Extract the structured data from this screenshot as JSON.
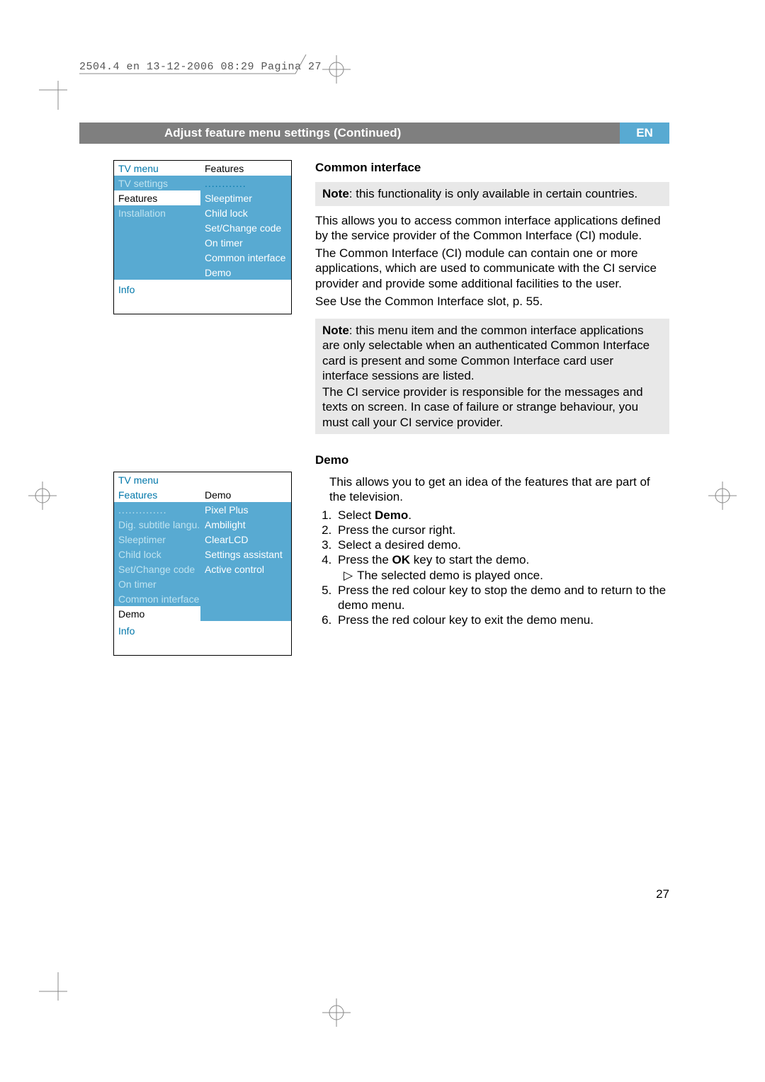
{
  "print_header": "2504.4 en  13-12-2006  08:29  Pagina 27",
  "title_bar": {
    "title": "Adjust feature menu settings  (Continued)",
    "lang": "EN"
  },
  "menu1": {
    "header_left": "TV menu",
    "header_right": "Features",
    "left": [
      "TV settings",
      "Features",
      "Installation"
    ],
    "right_dots": "............",
    "right": [
      "Sleeptimer",
      "Child lock",
      "Set/Change code",
      "On timer",
      "Common interface",
      "Demo"
    ],
    "info": "Info"
  },
  "menu2": {
    "header_left": "TV menu",
    "header_features": "Features",
    "header_right": "Demo",
    "left_dots": "..............",
    "left": [
      "Dig. subtitle langu.",
      "Sleeptimer",
      "Child lock",
      "Set/Change code",
      "On timer",
      "Common interface",
      "Demo"
    ],
    "right": [
      "Pixel Plus",
      "Ambilight",
      "ClearLCD",
      "Settings assistant",
      "Active control"
    ],
    "info": "Info"
  },
  "section1": {
    "heading": "Common interface",
    "note1_label": "Note",
    "note1": ": this functionality is only available in certain countries.",
    "p1": "This allows you to access common interface applications defined by the service provider of the Common Interface (CI) module.",
    "p2": "The Common Interface (CI) module can contain one or more applications, which are used to communicate with the CI service provider and provide some additional facilities to the user.",
    "p3": "See Use the Common Interface slot, p. 55.",
    "note2_label": "Note",
    "note2a": ": this menu item and the common interface applications are only selectable when an authenticated Common Interface card is present and some Common Interface card user interface sessions are listed.",
    "note2b": "The CI service provider is responsible for the messages and texts on screen. In case of failure or strange behaviour, you must call your CI service provider."
  },
  "section2": {
    "heading": "Demo",
    "intro": "This allows you to get an idea of the features that are part of the television.",
    "step1a": "Select ",
    "step1b": "Demo",
    "step1c": ".",
    "step2": "Press the cursor right.",
    "step3": "Select a desired demo.",
    "step4a": "Press the ",
    "step4b": "OK",
    "step4c": " key to start the demo.",
    "step4_sub": "The selected demo is played once.",
    "step5": "Press the red colour key to stop the demo and to return to the demo menu.",
    "step6": "Press the red colour key to exit the demo menu."
  },
  "page_number": "27"
}
